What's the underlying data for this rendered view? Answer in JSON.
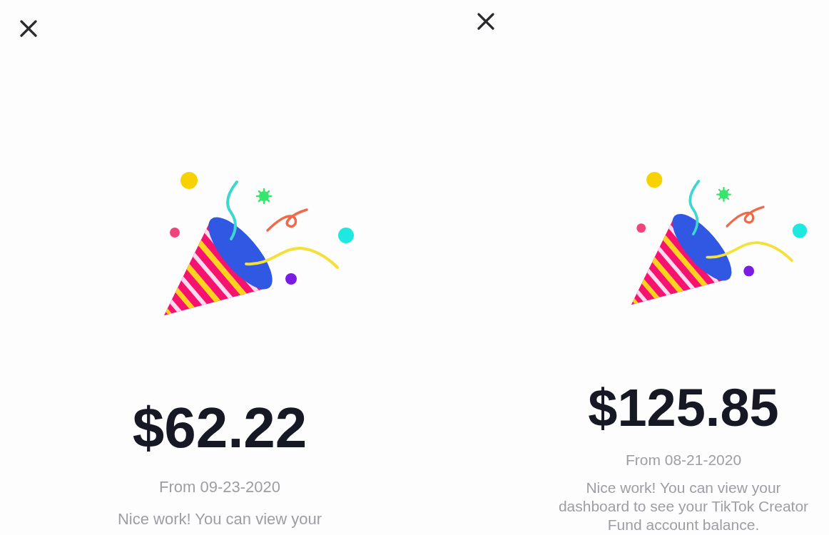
{
  "panels": [
    {
      "amount": "$62.22",
      "date": "From 09-23-2020",
      "message": "Nice work! You can view your"
    },
    {
      "amount": "$125.85",
      "date": "From 08-21-2020",
      "message": "Nice work! You can view your dashboard to see your TikTok Creator Fund account balance."
    }
  ]
}
